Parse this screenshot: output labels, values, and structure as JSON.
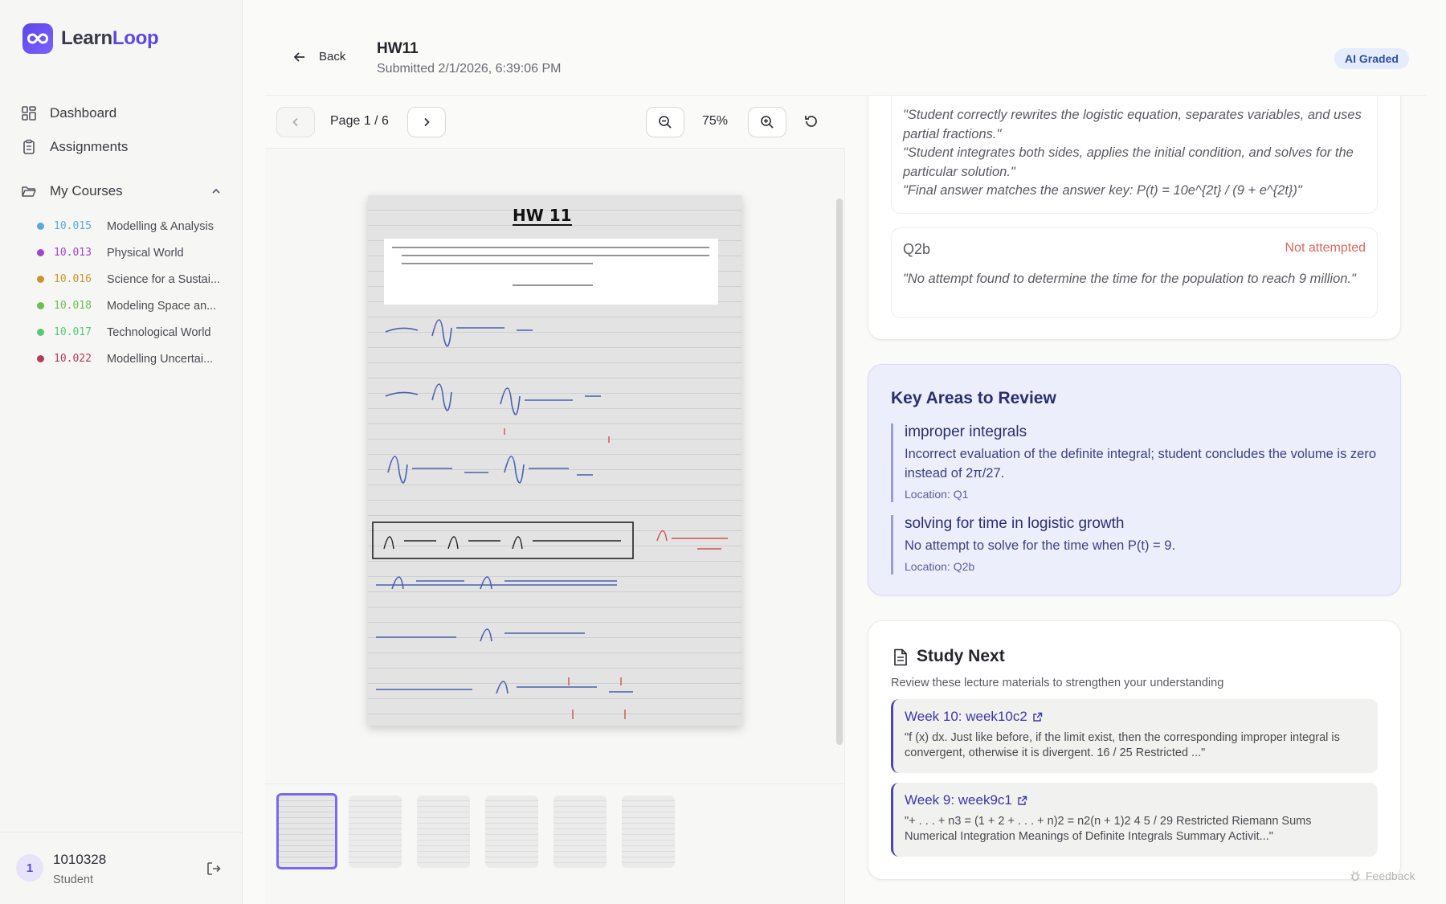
{
  "app": {
    "name_part1": "Learn",
    "name_part2": "Loop"
  },
  "nav": {
    "dashboard": "Dashboard",
    "assignments": "Assignments",
    "my_courses": "My Courses"
  },
  "courses": [
    {
      "code": "10.015",
      "name": "Modelling & Analysis",
      "color": "#5aaad6"
    },
    {
      "code": "10.013",
      "name": "Physical World",
      "color": "#a046c8"
    },
    {
      "code": "10.016",
      "name": "Science for a Sustai...",
      "color": "#c8962e"
    },
    {
      "code": "10.018",
      "name": "Modeling Space an...",
      "color": "#6cbe50"
    },
    {
      "code": "10.017",
      "name": "Technological World",
      "color": "#5ac878"
    },
    {
      "code": "10.022",
      "name": "Modelling Uncertai...",
      "color": "#b43c5a"
    }
  ],
  "user": {
    "avatar": "1",
    "id": "1010328",
    "role": "Student"
  },
  "header": {
    "back": "Back",
    "title": "HW11",
    "submitted": "Submitted 2/1/2026, 6:39:06 PM",
    "badge": "AI Graded"
  },
  "viewer": {
    "page_label": "Page 1 / 6",
    "zoom": "75%",
    "page_heading": "HW 11",
    "thumbnail_count": 6
  },
  "questions": {
    "q2a_quotes": [
      "\"Student correctly rewrites the logistic equation, separates variables, and uses partial fractions.\"",
      "\"Student integrates both sides, applies the initial condition, and solves for the particular solution.\"",
      "\"Final answer matches the answer key: P(t) = 10e^{2t} / (9 + e^{2t})\""
    ],
    "q2b": {
      "title": "Q2b",
      "status": "Not attempted",
      "quote": "\"No attempt found to determine the time for the population to reach 9 million.\""
    }
  },
  "review": {
    "title": "Key Areas to Review",
    "items": [
      {
        "title": "improper integrals",
        "desc": "Incorrect evaluation of the definite integral; student concludes the volume is zero instead of 2π/27.",
        "location": "Location: Q1"
      },
      {
        "title": "solving for time in logistic growth",
        "desc": "No attempt to solve for the time when P(t) = 9.",
        "location": "Location: Q2b"
      }
    ]
  },
  "study": {
    "title": "Study Next",
    "subtitle": "Review these lecture materials to strengthen your understanding",
    "items": [
      {
        "title": "Week 10: week10c2",
        "text": "\"f (x) dx. Just like before, if the limit exist, then the corresponding improper integral is convergent, otherwise it is divergent. 16 / 25 Restricted ...\""
      },
      {
        "title": "Week 9: week9c1",
        "text": "\"+ . . . + n3 = (1 + 2 + . . . + n)2 = n2(n + 1)2 4 5 / 29 Restricted Riemann Sums Numerical Integration Meanings of Definite Integrals Summary Activit...\""
      }
    ]
  },
  "feedback": "Feedback",
  "colors": {
    "accent": "#5b47e6",
    "badge_bg": "#e5ecfb",
    "review_bg": "#eceefb",
    "status_red": "#d46a5e"
  }
}
